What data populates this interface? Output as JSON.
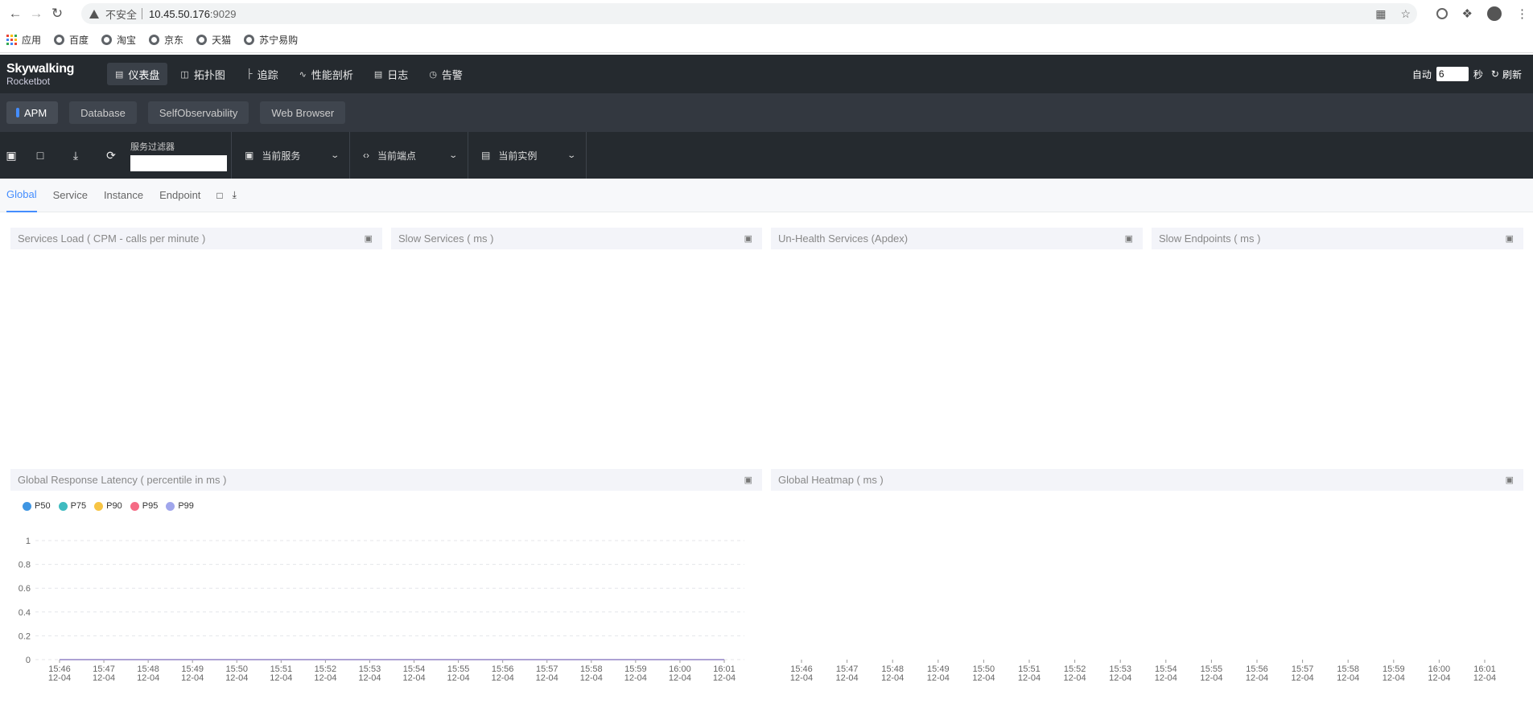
{
  "browser": {
    "insecure_label": "不安全",
    "url_host": "10.45.50.176",
    "url_port": ":9029",
    "bookmarks": [
      {
        "label": "应用"
      },
      {
        "label": "百度"
      },
      {
        "label": "淘宝"
      },
      {
        "label": "京东"
      },
      {
        "label": "天猫"
      },
      {
        "label": "苏宁易购"
      }
    ]
  },
  "header": {
    "logo_main": "Skywalking",
    "logo_sub": "Rocketbot",
    "nav": [
      {
        "label": "仪表盘",
        "icon": "dashboard-icon"
      },
      {
        "label": "拓扑图",
        "icon": "topology-icon"
      },
      {
        "label": "追踪",
        "icon": "trace-icon"
      },
      {
        "label": "性能剖析",
        "icon": "profile-icon"
      },
      {
        "label": "日志",
        "icon": "log-icon"
      },
      {
        "label": "告警",
        "icon": "alarm-icon"
      }
    ],
    "auto_label": "自动",
    "auto_value": "6",
    "seconds_label": "秒",
    "refresh_label": "刷新"
  },
  "dash_tabs": [
    "APM",
    "Database",
    "SelfObservability",
    "Web Browser"
  ],
  "toolbar": {
    "filter_label": "服务过滤器",
    "filter_value": "",
    "service_label": "当前服务",
    "endpoint_label": "当前端点",
    "instance_label": "当前实例"
  },
  "sub_tabs": [
    "Global",
    "Service",
    "Instance",
    "Endpoint"
  ],
  "panels": {
    "services_load": "Services Load ( CPM - calls per minute )",
    "slow_services": "Slow Services ( ms )",
    "unhealth_services": "Un-Health Services (Apdex)",
    "slow_endpoints": "Slow Endpoints ( ms )",
    "latency": "Global Response Latency ( percentile in ms )",
    "heatmap": "Global Heatmap ( ms )"
  },
  "chart_data": [
    {
      "type": "line",
      "title": "Global Response Latency ( percentile in ms )",
      "x": [
        "15:46\n12-04",
        "15:47\n12-04",
        "15:48\n12-04",
        "15:49\n12-04",
        "15:50\n12-04",
        "15:51\n12-04",
        "15:52\n12-04",
        "15:53\n12-04",
        "15:54\n12-04",
        "15:55\n12-04",
        "15:56\n12-04",
        "15:57\n12-04",
        "15:58\n12-04",
        "15:59\n12-04",
        "16:00\n12-04",
        "16:01\n12-04"
      ],
      "x_times": [
        "15:46",
        "15:47",
        "15:48",
        "15:49",
        "15:50",
        "15:51",
        "15:52",
        "15:53",
        "15:54",
        "15:55",
        "15:56",
        "15:57",
        "15:58",
        "15:59",
        "16:00",
        "16:01"
      ],
      "x_dates": [
        "12-04",
        "12-04",
        "12-04",
        "12-04",
        "12-04",
        "12-04",
        "12-04",
        "12-04",
        "12-04",
        "12-04",
        "12-04",
        "12-04",
        "12-04",
        "12-04",
        "12-04",
        "12-04"
      ],
      "y_ticks": [
        "0",
        "0.2",
        "0.4",
        "0.6",
        "0.8",
        "1"
      ],
      "ylim": [
        0,
        1
      ],
      "series": [
        {
          "name": "P50",
          "color": "#3f96e3",
          "values": [
            0,
            0,
            0,
            0,
            0,
            0,
            0,
            0,
            0,
            0,
            0,
            0,
            0,
            0,
            0,
            0
          ]
        },
        {
          "name": "P75",
          "color": "#3fbbc0",
          "values": [
            0,
            0,
            0,
            0,
            0,
            0,
            0,
            0,
            0,
            0,
            0,
            0,
            0,
            0,
            0,
            0
          ]
        },
        {
          "name": "P90",
          "color": "#f7c444",
          "values": [
            0,
            0,
            0,
            0,
            0,
            0,
            0,
            0,
            0,
            0,
            0,
            0,
            0,
            0,
            0,
            0
          ]
        },
        {
          "name": "P95",
          "color": "#f56b85",
          "values": [
            0,
            0,
            0,
            0,
            0,
            0,
            0,
            0,
            0,
            0,
            0,
            0,
            0,
            0,
            0,
            0
          ]
        },
        {
          "name": "P99",
          "color": "#a0a6ec",
          "values": [
            0,
            0,
            0,
            0,
            0,
            0,
            0,
            0,
            0,
            0,
            0,
            0,
            0,
            0,
            0,
            0
          ]
        }
      ],
      "legend": "top-left",
      "grid": true
    },
    {
      "type": "heatmap",
      "title": "Global Heatmap ( ms )",
      "x_times": [
        "15:46",
        "15:47",
        "15:48",
        "15:49",
        "15:50",
        "15:51",
        "15:52",
        "15:53",
        "15:54",
        "15:55",
        "15:56",
        "15:57",
        "15:58",
        "15:59",
        "16:00",
        "16:01"
      ],
      "x_dates": [
        "12-04",
        "12-04",
        "12-04",
        "12-04",
        "12-04",
        "12-04",
        "12-04",
        "12-04",
        "12-04",
        "12-04",
        "12-04",
        "12-04",
        "12-04",
        "12-04",
        "12-04",
        "12-04"
      ],
      "values": []
    }
  ]
}
